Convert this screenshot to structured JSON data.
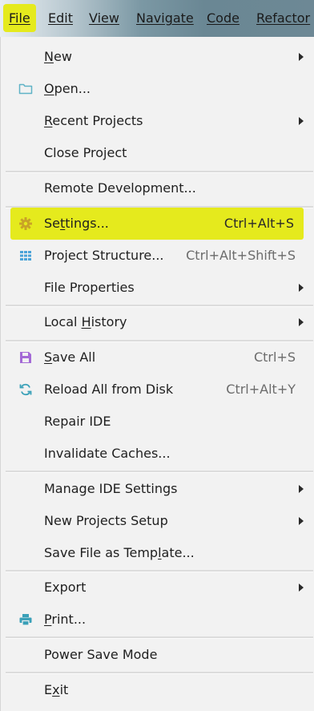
{
  "menubar": {
    "items": [
      {
        "label": "File",
        "underline": "F"
      },
      {
        "label": "Edit",
        "underline": "E"
      },
      {
        "label": "View",
        "underline": "V"
      },
      {
        "label": "Navigate",
        "underline": "N"
      },
      {
        "label": "Code",
        "underline": "C"
      },
      {
        "label": "Refactor",
        "underline": "R"
      }
    ]
  },
  "menu": {
    "new": {
      "label_pre": "",
      "label_u": "N",
      "label_post": "ew"
    },
    "open": {
      "label_pre": "",
      "label_u": "O",
      "label_post": "pen..."
    },
    "recent_projects": {
      "label_pre": "",
      "label_u": "R",
      "label_post": "ecent Projects"
    },
    "close_project": {
      "label": "Close Project"
    },
    "remote_development": {
      "label": "Remote Development..."
    },
    "settings": {
      "label_pre": "Se",
      "label_u": "t",
      "label_post": "tings...",
      "shortcut": "Ctrl+Alt+S"
    },
    "project_structure": {
      "label": "Project Structure...",
      "shortcut": "Ctrl+Alt+Shift+S"
    },
    "file_properties": {
      "label": "File Properties"
    },
    "local_history": {
      "label_pre": "Local ",
      "label_u": "H",
      "label_post": "istory"
    },
    "save_all": {
      "label_pre": "",
      "label_u": "S",
      "label_post": "ave All",
      "shortcut": "Ctrl+S"
    },
    "reload_all": {
      "label": "Reload All from Disk",
      "shortcut": "Ctrl+Alt+Y"
    },
    "repair_ide": {
      "label": "Repair IDE"
    },
    "invalidate_caches": {
      "label": "Invalidate Caches..."
    },
    "manage_ide_settings": {
      "label": "Manage IDE Settings"
    },
    "new_projects_setup": {
      "label": "New Projects Setup"
    },
    "save_as_template": {
      "label_pre": "Save File as Temp",
      "label_u": "l",
      "label_post": "ate..."
    },
    "export": {
      "label": "Export"
    },
    "print": {
      "label_pre": "",
      "label_u": "P",
      "label_post": "rint..."
    },
    "power_save_mode": {
      "label": "Power Save Mode"
    },
    "exit": {
      "label_pre": "E",
      "label_u": "x",
      "label_post": "it"
    }
  },
  "colors": {
    "highlight": "#e5ea1d",
    "menu_bg": "#f2f2f2",
    "folder_icon": "#5fb3c6",
    "settings_icon": "#c9a227",
    "save_icon": "#a46ad6",
    "reload_icon": "#3aa0b8",
    "print_icon": "#3aa0b8"
  }
}
